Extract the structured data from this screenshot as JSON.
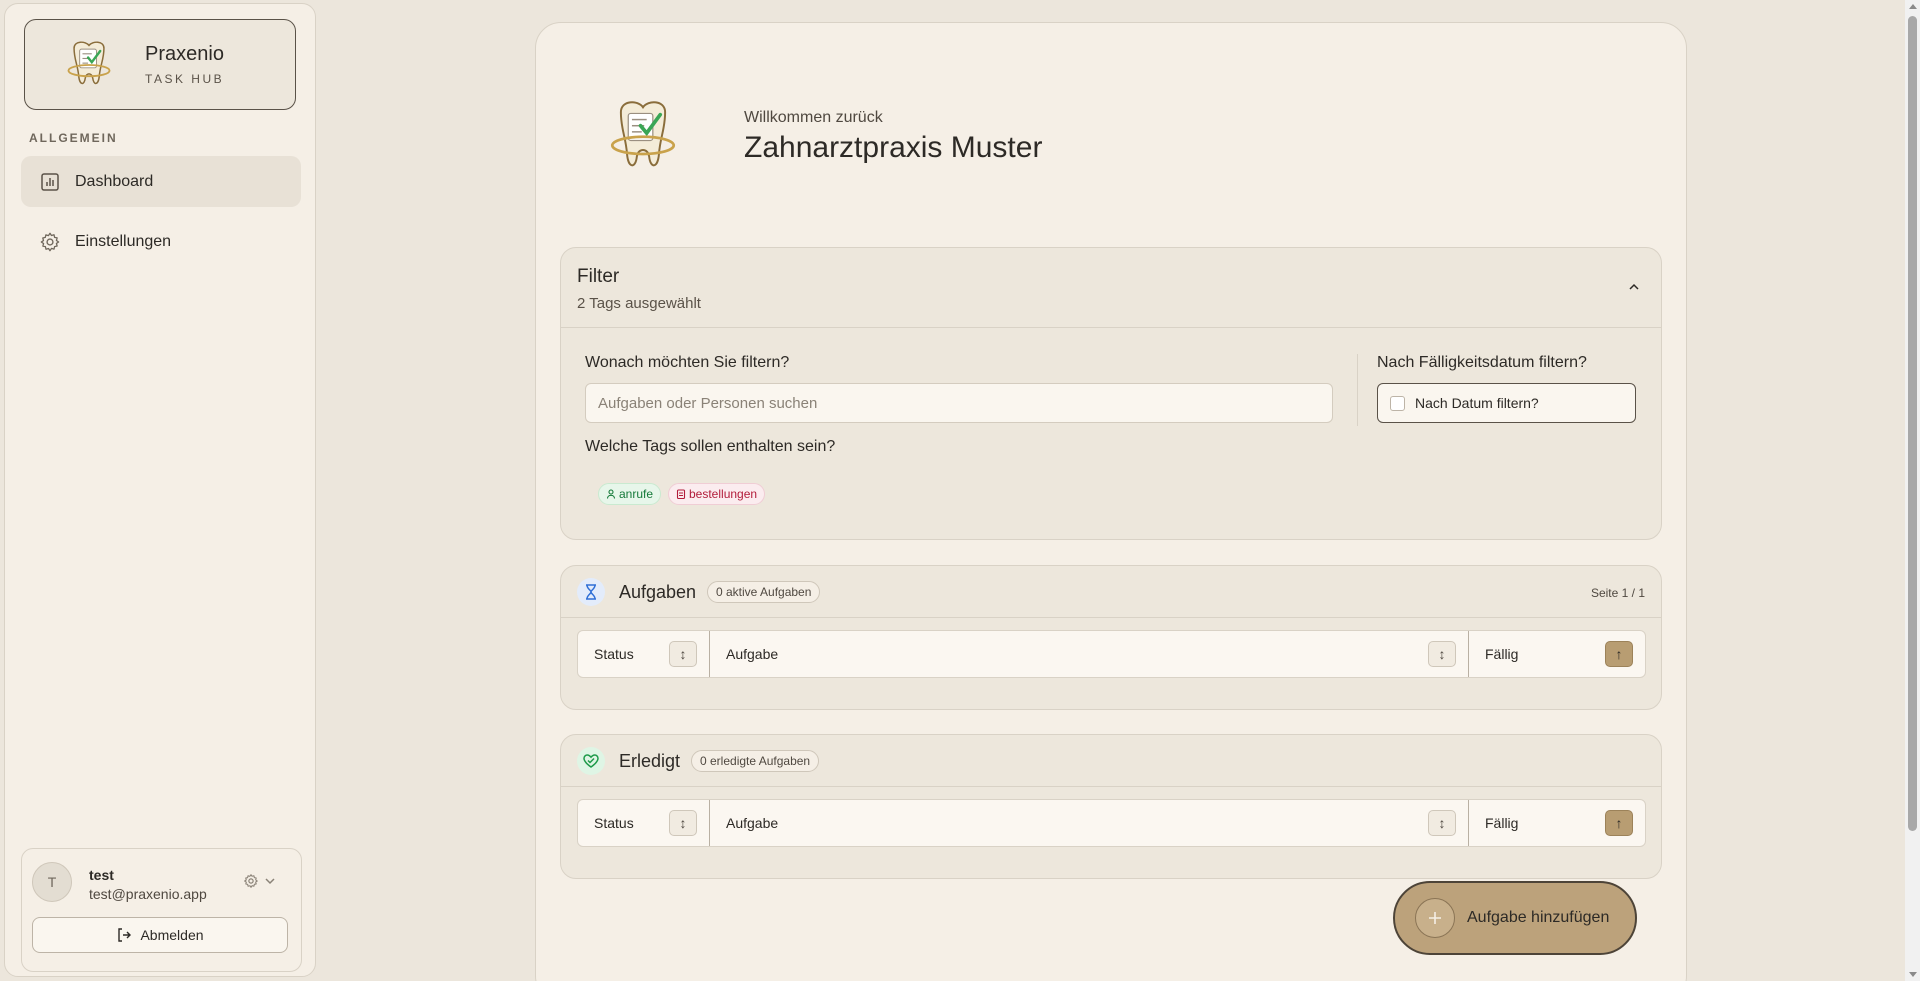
{
  "sidebar": {
    "brand": {
      "name": "Praxenio",
      "subtitle": "TASK HUB"
    },
    "section_label": "ALLGEMEIN",
    "items": [
      {
        "label": "Dashboard",
        "icon": "bar-chart-icon",
        "active": true
      },
      {
        "label": "Einstellungen",
        "icon": "gear-icon",
        "active": false
      }
    ],
    "user": {
      "initial": "T",
      "name": "test",
      "email": "test@praxenio.app",
      "logout_label": "Abmelden"
    }
  },
  "header": {
    "welcome": "Willkommen zurück",
    "practice_name": "Zahnarztpraxis Muster"
  },
  "filter": {
    "title": "Filter",
    "subtitle": "2 Tags ausgewählt",
    "search_label": "Wonach möchten Sie filtern?",
    "search_placeholder": "Aufgaben oder Personen suchen",
    "search_value": "",
    "date_label": "Nach Fälligkeitsdatum filtern?",
    "date_checkbox_label": "Nach Datum filtern?",
    "date_checked": false,
    "tags_label": "Welche Tags sollen enthalten sein?",
    "tags": [
      {
        "label": "anrufe",
        "icon": "user-icon",
        "color": "#167a3a"
      },
      {
        "label": "bestellungen",
        "icon": "clipboard-icon",
        "color": "#b21c3a"
      }
    ]
  },
  "tasks": {
    "title": "Aufgaben",
    "badge": "0 aktive Aufgaben",
    "page": "Seite 1 / 1",
    "columns": {
      "status": "Status",
      "task": "Aufgabe",
      "due": "Fällig"
    }
  },
  "done": {
    "title": "Erledigt",
    "badge": "0 erledigte Aufgaben",
    "columns": {
      "status": "Status",
      "task": "Aufgabe",
      "due": "Fällig"
    }
  },
  "sort_icons": {
    "neutral": "↕",
    "asc": "↑"
  },
  "fab": {
    "label": "Aufgabe hinzufügen"
  },
  "colors": {
    "accent": "#bca27b",
    "background": "#ece6dc",
    "panel": "#f5efe6"
  }
}
